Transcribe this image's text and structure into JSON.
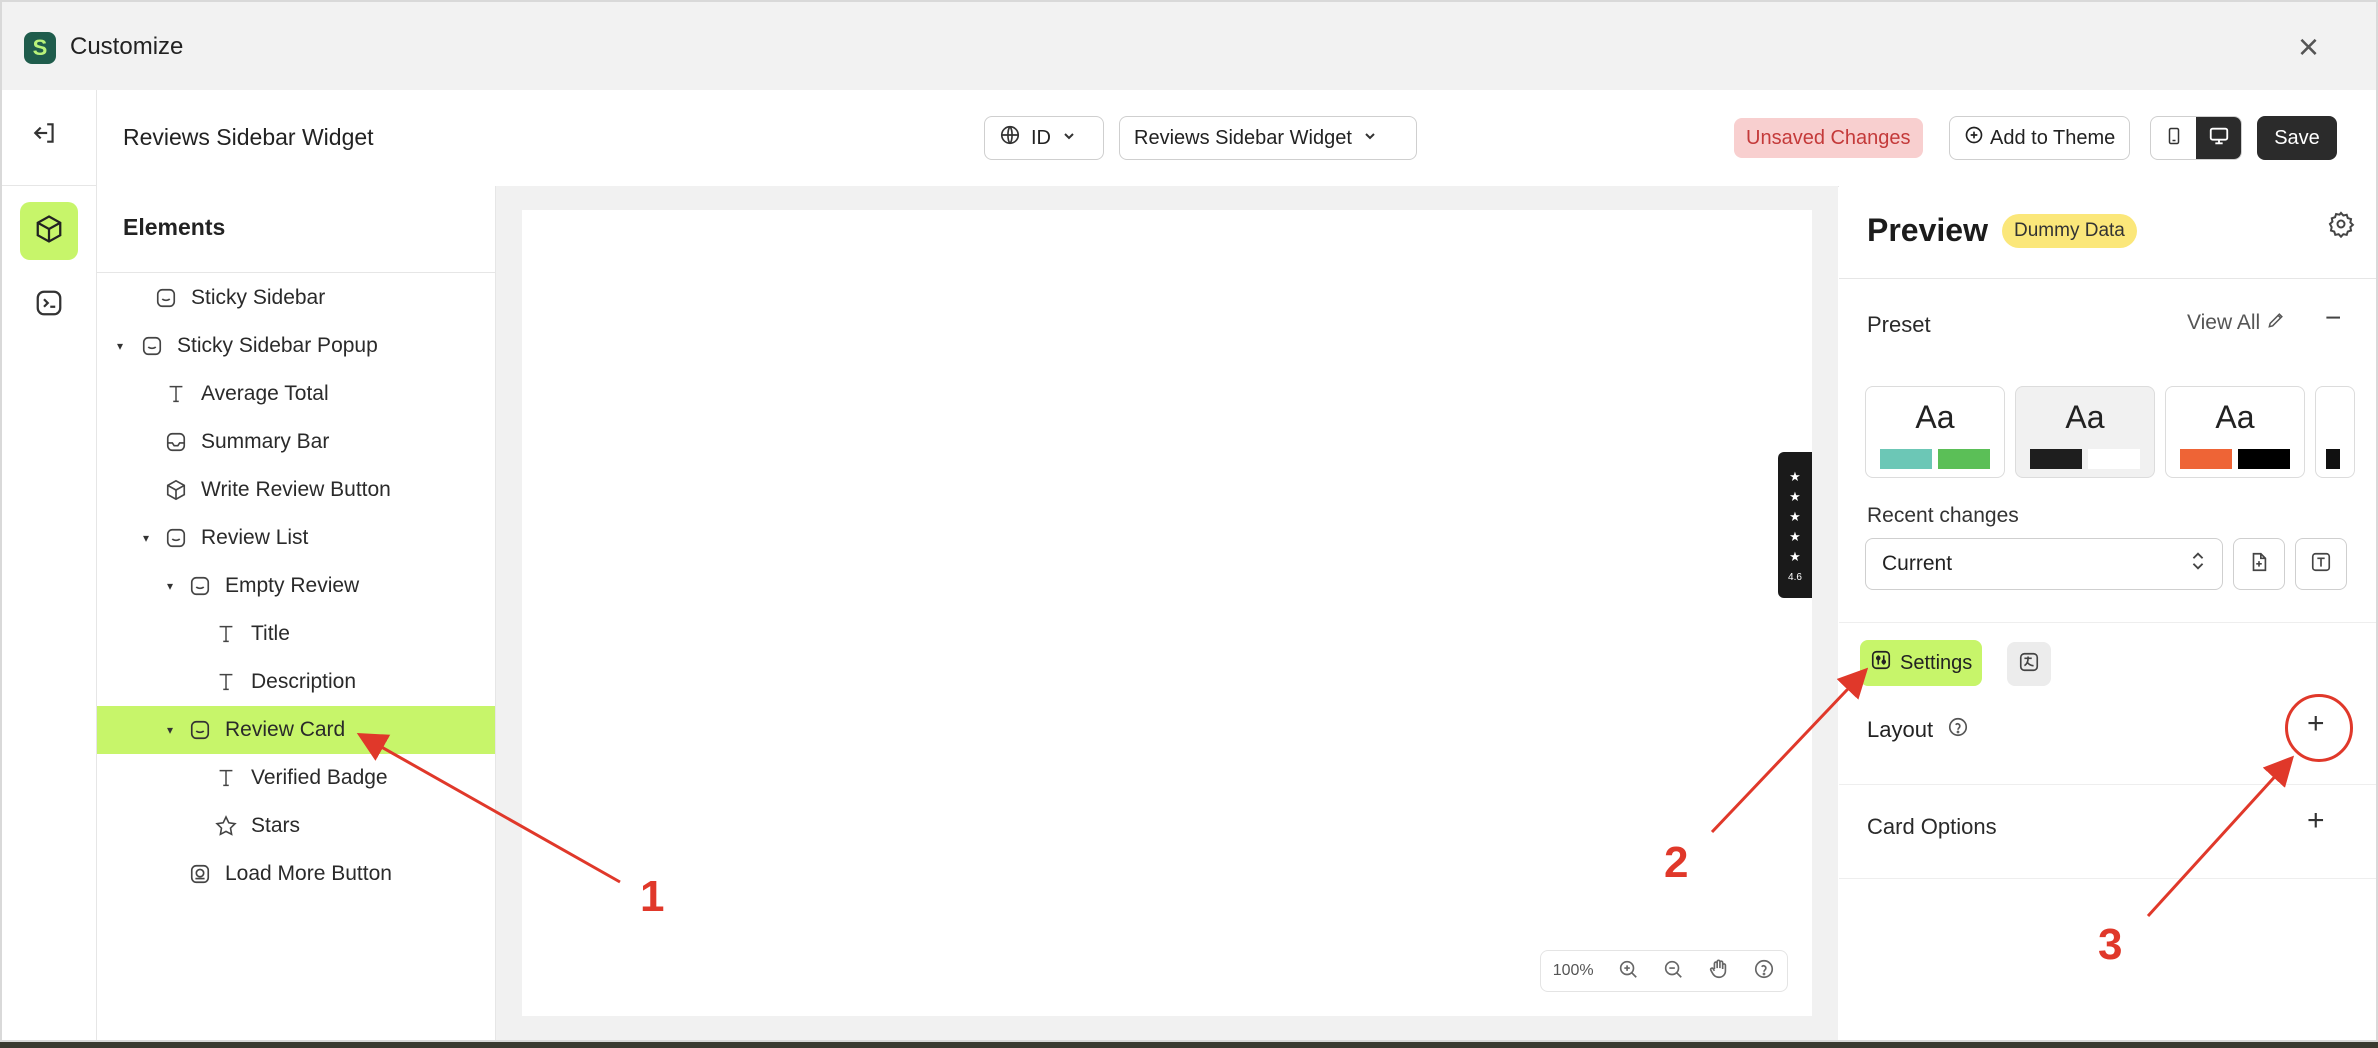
{
  "window": {
    "title": "Customize",
    "close_icon": "×"
  },
  "rail": {
    "exit_icon": "exit-icon",
    "items": [
      {
        "icon": "cube-icon",
        "active": true
      },
      {
        "icon": "terminal-icon",
        "active": false
      }
    ]
  },
  "topbar": {
    "page_name": "Reviews Sidebar Widget",
    "language": "ID",
    "widget_select": "Reviews Sidebar Widget",
    "unsaved": "Unsaved Changes",
    "add_to_theme": "Add to Theme",
    "save": "Save"
  },
  "elements": {
    "header": "Elements",
    "items": [
      {
        "label": "Sticky Sidebar",
        "icon": "layout-icon",
        "caret": false
      },
      {
        "label": "Sticky Sidebar Popup",
        "icon": "layout-icon",
        "caret": true
      },
      {
        "label": "Average Total",
        "icon": "text-icon",
        "caret": false
      },
      {
        "label": "Summary Bar",
        "icon": "layout-icon",
        "caret": false
      },
      {
        "label": "Write Review Button",
        "icon": "cube-icon",
        "caret": false
      },
      {
        "label": "Review List",
        "icon": "layout-icon",
        "caret": true
      },
      {
        "label": "Empty Review",
        "icon": "layout-icon",
        "caret": true
      },
      {
        "label": "Title",
        "icon": "text-icon",
        "caret": false
      },
      {
        "label": "Description",
        "icon": "text-icon",
        "caret": false
      },
      {
        "label": "Review Card",
        "icon": "layout-icon",
        "caret": true,
        "selected": true
      },
      {
        "label": "Verified Badge",
        "icon": "text-icon",
        "caret": false
      },
      {
        "label": "Stars",
        "icon": "star-icon",
        "caret": false
      },
      {
        "label": "Load More Button",
        "icon": "button-icon",
        "caret": false
      }
    ]
  },
  "canvas": {
    "review_tab_rating": "4.6",
    "zoom": "100%"
  },
  "preview": {
    "title": "Preview",
    "badge": "Dummy Data",
    "preset_label": "Preset",
    "view_all": "View All",
    "presets": [
      {
        "label": "Aa",
        "colors": [
          "#6cc7b6",
          "#5bbf57"
        ]
      },
      {
        "label": "Aa",
        "colors": [
          "#1e1e1e",
          "#ffffff"
        ]
      },
      {
        "label": "Aa",
        "colors": [
          "#ee6436",
          "#000000"
        ]
      }
    ],
    "recent_changes_label": "Recent changes",
    "recent_changes_value": "Current",
    "settings_tab": "Settings",
    "layout_label": "Layout",
    "card_options_label": "Card Options"
  },
  "annotations": [
    "1",
    "2",
    "3"
  ],
  "colors": {
    "accent": "#c7f56a",
    "annotation": "#e0382a",
    "unsaved_bg": "#f8cfcf",
    "badge_bg": "#fbe77a"
  }
}
